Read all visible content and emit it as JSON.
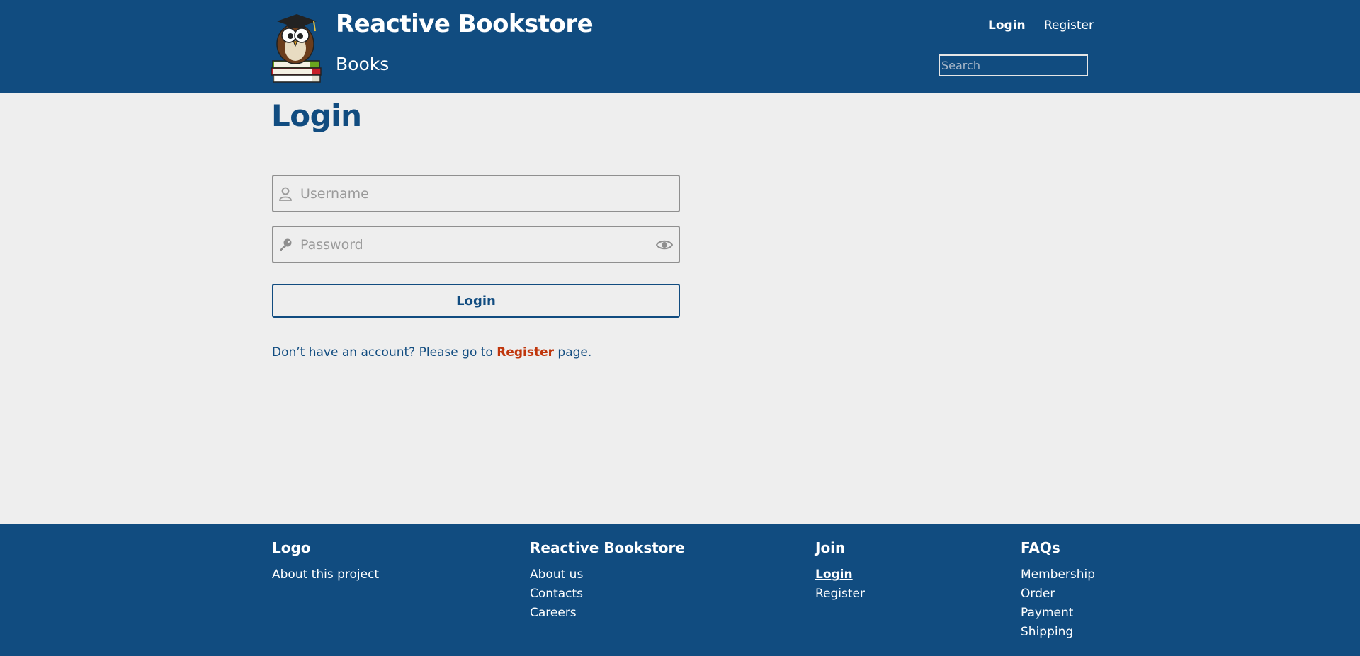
{
  "header": {
    "brand_title": "Reactive Bookstore",
    "subtitle": "Books",
    "nav": {
      "login": "Login",
      "register": "Register"
    },
    "search_placeholder": "Search"
  },
  "main": {
    "title": "Login",
    "username_placeholder": "Username",
    "password_placeholder": "Password",
    "login_button": "Login",
    "hint_prefix": "Don’t have an account? Please go to ",
    "hint_link": "Register",
    "hint_suffix": " page."
  },
  "footer": {
    "columns": [
      {
        "heading": "Logo",
        "links": [
          "About this project"
        ]
      },
      {
        "heading": "Reactive Bookstore",
        "links": [
          "About us",
          "Contacts",
          "Careers"
        ]
      },
      {
        "heading": "Join",
        "links": [
          "Login",
          "Register"
        ]
      },
      {
        "heading": "FAQs",
        "links": [
          "Membership",
          "Order",
          "Payment",
          "Shipping"
        ]
      }
    ]
  },
  "colors": {
    "primary": "#114c80",
    "background": "#eeeeee",
    "link_accent": "#c0360c"
  },
  "icons": [
    "owl-logo",
    "user-icon",
    "key-icon",
    "eye-icon"
  ]
}
